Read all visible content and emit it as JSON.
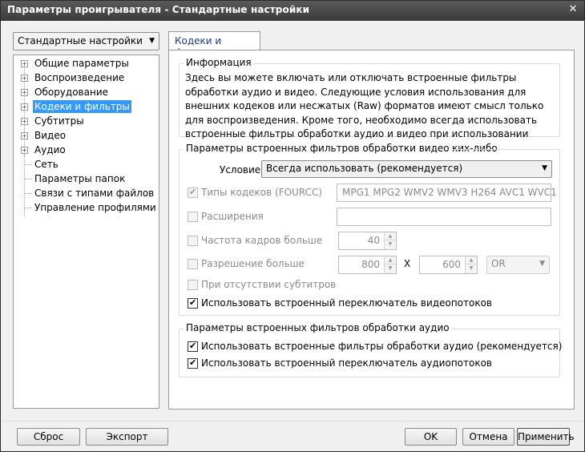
{
  "window": {
    "title": "Параметры проигрывателя - Стандартные настройки",
    "close_glyph": "✕"
  },
  "profile": {
    "selected": "Стандартные настройки"
  },
  "tree": {
    "items": [
      {
        "label": "Общие параметры",
        "expandable": true
      },
      {
        "label": "Воспроизведение",
        "expandable": true
      },
      {
        "label": "Оборудование",
        "expandable": true
      },
      {
        "label": "Кодеки и фильтры",
        "expandable": true,
        "selected": true
      },
      {
        "label": "Субтитры",
        "expandable": true
      },
      {
        "label": "Видео",
        "expandable": true
      },
      {
        "label": "Аудио",
        "expandable": true
      },
      {
        "label": "Сеть",
        "expandable": false
      },
      {
        "label": "Параметры папок",
        "expandable": false
      },
      {
        "label": "Связи с типами файлов",
        "expandable": false
      },
      {
        "label": "Управление профилями",
        "expandable": false
      }
    ]
  },
  "tab": {
    "label": "Кодеки и фильтры"
  },
  "info": {
    "title": "Информация",
    "text": "Здесь вы можете включать или отключать встроенные фильтры обработки аудио и видео. Следующие условия использования для внешних кодеков или несжатых (Raw) форматов имеют смысл только для воспроизведения. Кроме того, необходимо всегда использовать встроенные фильтры обработки аудио и видео при использовании различных функций типа записи видео, если нет каких-либо"
  },
  "video_group": {
    "title": "Параметры встроенных фильтров обработки видео",
    "condition_label": "Условие",
    "condition_value": "Всегда использовать (рекомендуется)",
    "codec_types_label": "Типы кодеков (FOURCC)",
    "codec_types_value": "MPG1 MPG2 WMV2 WMV3 H264 AVC1 WVC1",
    "extensions_label": "Расширения",
    "extensions_value": "",
    "framerate_label": "Частота кадров больше",
    "framerate_value": "40",
    "resolution_label": "Разрешение больше",
    "res_width": "800",
    "res_x": "X",
    "res_height": "600",
    "res_op": "OR",
    "no_subs_label": "При отсутствии субтитров",
    "use_switch_label": "Использовать встроенный переключатель видеопотоков"
  },
  "audio_group": {
    "title": "Параметры встроенных фильтров обработки аудио",
    "use_filters_label": "Использовать встроенные фильтры обработки аудио (рекомендуется)",
    "use_switch_label": "Использовать встроенный переключатель аудиопотоков"
  },
  "buttons": {
    "reset": "Сброс",
    "export": "Экспорт",
    "ok": "OK",
    "cancel": "Отмена",
    "apply": "Применить"
  },
  "glyphs": {
    "check": "✔",
    "dropdown": "▼",
    "spin_up": "▲",
    "spin_down": "▼",
    "plus": "+"
  }
}
